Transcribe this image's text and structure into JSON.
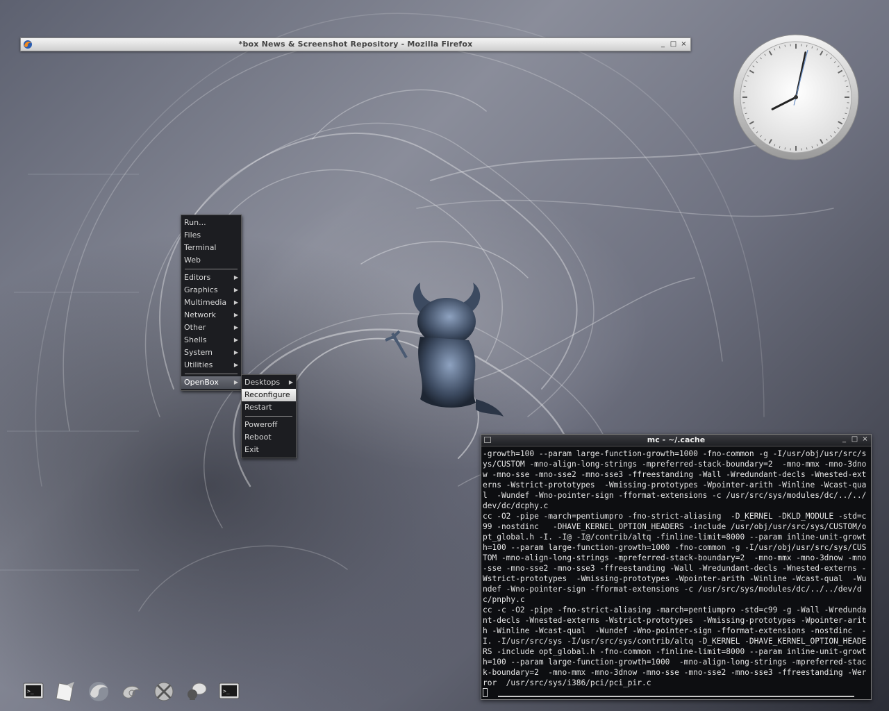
{
  "firefox_window": {
    "title": "*box News & Screenshot Repository - Mozilla Firefox",
    "icon": "firefox-icon",
    "buttons": [
      "_",
      "□",
      "×"
    ]
  },
  "clock": {
    "hour_hand_angle_deg": 243,
    "minute_hand_angle_deg": 12,
    "second_hand_angle_deg": 14
  },
  "root_menu": {
    "items": [
      {
        "label": "Run...",
        "submenu": false
      },
      {
        "label": "Files",
        "submenu": false
      },
      {
        "label": "Terminal",
        "submenu": false
      },
      {
        "label": "Web",
        "submenu": false
      },
      {
        "separator": true
      },
      {
        "label": "Editors",
        "submenu": true
      },
      {
        "label": "Graphics",
        "submenu": true
      },
      {
        "label": "Multimedia",
        "submenu": true
      },
      {
        "label": "Network",
        "submenu": true
      },
      {
        "label": "Other",
        "submenu": true
      },
      {
        "label": "Shells",
        "submenu": true
      },
      {
        "label": "System",
        "submenu": true
      },
      {
        "label": "Utilities",
        "submenu": true
      },
      {
        "separator": true
      },
      {
        "label": "OpenBox",
        "submenu": true,
        "active": true
      }
    ]
  },
  "openbox_submenu": {
    "items": [
      {
        "label": "Desktops",
        "submenu": true
      },
      {
        "label": "Reconfigure",
        "submenu": false,
        "highlighted": true
      },
      {
        "label": "Restart",
        "submenu": false
      },
      {
        "separator": true
      },
      {
        "label": "Poweroff",
        "submenu": false
      },
      {
        "label": "Reboot",
        "submenu": false
      },
      {
        "label": "Exit",
        "submenu": false
      }
    ]
  },
  "terminal": {
    "title": "mc - ~/.cache",
    "buttons": [
      "_",
      "□",
      "×"
    ],
    "output": "-growth=100 --param large-function-growth=1000 -fno-common -g -I/usr/obj/usr/src/sys/CUSTOM -mno-align-long-strings -mpreferred-stack-boundary=2  -mno-mmx -mno-3dnow -mno-sse -mno-sse2 -mno-sse3 -ffreestanding -Wall -Wredundant-decls -Wnested-externs -Wstrict-prototypes  -Wmissing-prototypes -Wpointer-arith -Winline -Wcast-qual  -Wundef -Wno-pointer-sign -fformat-extensions -c /usr/src/sys/modules/dc/../../dev/dc/dcphy.c\ncc -O2 -pipe -march=pentiumpro -fno-strict-aliasing  -D_KERNEL -DKLD_MODULE -std=c99 -nostdinc   -DHAVE_KERNEL_OPTION_HEADERS -include /usr/obj/usr/src/sys/CUSTOM/opt_global.h -I. -I@ -I@/contrib/altq -finline-limit=8000 --param inline-unit-growth=100 --param large-function-growth=1000 -fno-common -g -I/usr/obj/usr/src/sys/CUSTOM -mno-align-long-strings -mpreferred-stack-boundary=2  -mno-mmx -mno-3dnow -mno-sse -mno-sse2 -mno-sse3 -ffreestanding -Wall -Wredundant-decls -Wnested-externs -Wstrict-prototypes  -Wmissing-prototypes -Wpointer-arith -Winline -Wcast-qual  -Wundef -Wno-pointer-sign -fformat-extensions -c /usr/src/sys/modules/dc/../../dev/dc/pnphy.c\ncc -c -O2 -pipe -fno-strict-aliasing -march=pentiumpro -std=c99 -g -Wall -Wredundant-decls -Wnested-externs -Wstrict-prototypes  -Wmissing-prototypes -Wpointer-arith -Winline -Wcast-qual  -Wundef -Wno-pointer-sign -fformat-extensions -nostdinc  -I. -I/usr/src/sys -I/usr/src/sys/contrib/altq -D_KERNEL -DHAVE_KERNEL_OPTION_HEADERS -include opt_global.h -fno-common -finline-limit=8000 --param inline-unit-growth=100 --param large-function-growth=1000  -mno-align-long-strings -mpreferred-stack-boundary=2  -mno-mmx -mno-3dnow -mno-sse -mno-sse2 -mno-sse3 -ffreestanding -Werror  /usr/src/sys/i386/pci/pci_pir.c"
  },
  "dock": {
    "icons": [
      "terminal-icon",
      "text-editor-icon",
      "firefox-icon",
      "shell-icon",
      "network-icon",
      "chat-icon",
      "terminal-icon"
    ]
  },
  "colors": {
    "menu_bg": "#1c1d21",
    "menu_text": "#d8d8d8",
    "terminal_bg": "#0d0e11",
    "terminal_text": "#e6e6e6"
  }
}
